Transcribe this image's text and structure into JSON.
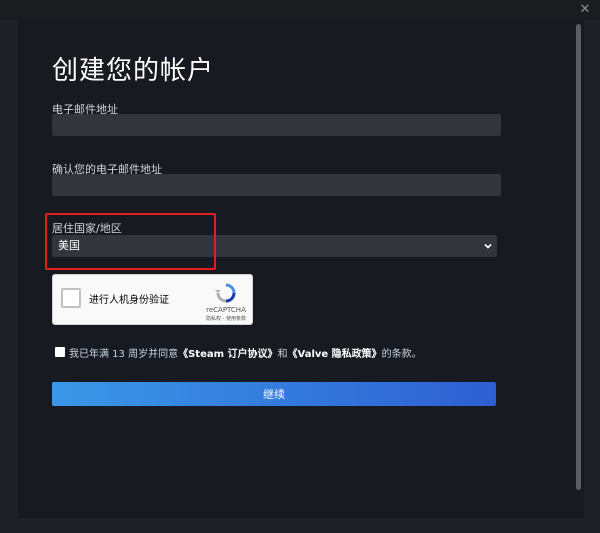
{
  "page": {
    "title": "创建您的帐户"
  },
  "form": {
    "email_label": "电子邮件地址",
    "email_value": "",
    "confirm_email_label": "确认您的电子邮件地址",
    "confirm_email_value": "",
    "country_label": "居住国家/地区",
    "country_value": "美国"
  },
  "recaptcha": {
    "label": "进行人机身份验证",
    "brand": "reCAPTCHA",
    "links": "隐私权 - 使用条款"
  },
  "agreement": {
    "prefix": "我已年满 13 周岁并同意",
    "link1": "《Steam 订户协议》",
    "middle": "和",
    "link2": "《Valve 隐私政策》",
    "suffix": "的条款。"
  },
  "continue_label": "继续",
  "colors": {
    "background": "#1f2126",
    "panel": "#181a21",
    "field": "#32353c",
    "highlight": "#e02020",
    "button_start": "#3a98e8",
    "button_end": "#2e5fd2"
  },
  "icons": {
    "close": "close-icon",
    "dropdown": "chevron-down-icon",
    "recaptcha_logo": "recaptcha-logo-icon"
  }
}
